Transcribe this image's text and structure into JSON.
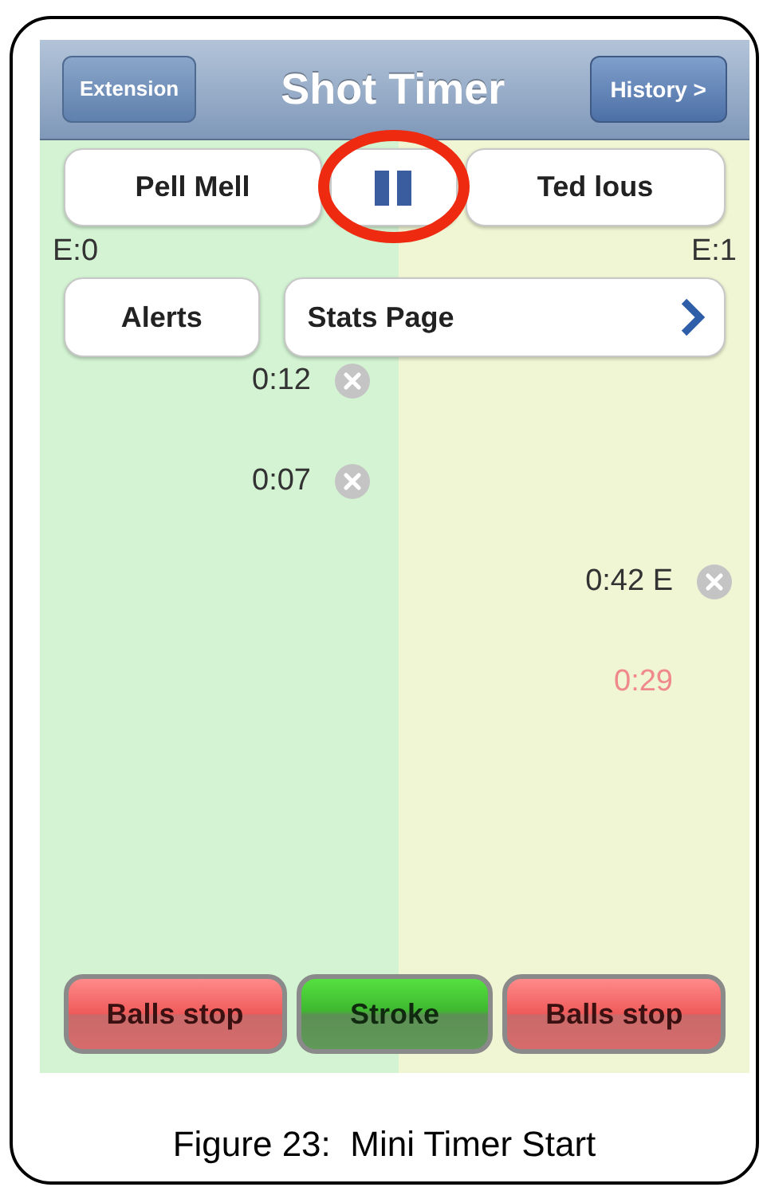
{
  "nav_bar": {
    "left_button": "Extension",
    "title": "Shot Timer",
    "right_button": "History >"
  },
  "players": [
    {
      "name": "Pell Mell",
      "extensions": "E:0"
    },
    {
      "name": "Ted lous",
      "extensions": "E:1"
    }
  ],
  "pause_button": {
    "highlighted": true
  },
  "alerts_button": "Alerts",
  "stats_button": "Stats Page",
  "entries": [
    {
      "time": "0:12",
      "kind": "left",
      "deletable": true,
      "color": "#333333"
    },
    {
      "time": "0:07",
      "kind": "left",
      "deletable": true,
      "color": "#333333"
    },
    {
      "time": "0:42 E",
      "kind": "right",
      "deletable": true,
      "color": "#333333"
    },
    {
      "time": "0:29",
      "kind": "right",
      "deletable": false,
      "color": "#f08a8a"
    }
  ],
  "bottom_buttons": [
    {
      "label": "Balls stop",
      "kind": "stop"
    },
    {
      "label": "Stroke",
      "kind": "stroke"
    },
    {
      "label": "Balls stop",
      "kind": "stop"
    }
  ],
  "caption": "Figure 23:  Mini Timer Start"
}
